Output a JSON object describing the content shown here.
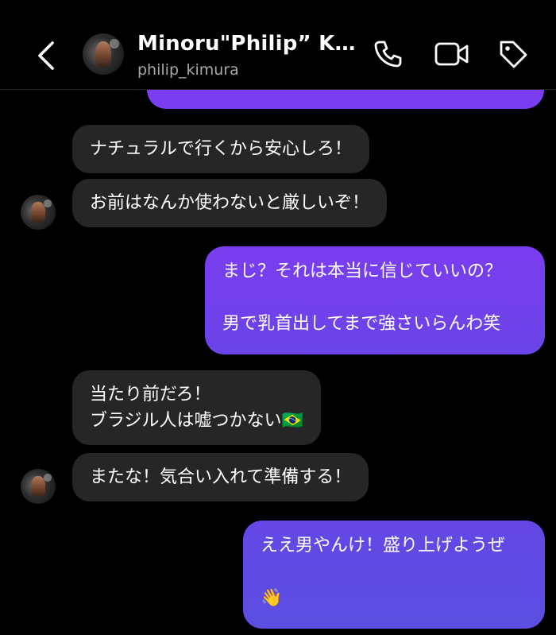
{
  "header": {
    "title": "Minoru\"Philip” Kim...",
    "username": "philip_kimura",
    "icons": [
      "chevron-left-icon",
      "phone-icon",
      "video-camera-icon",
      "tag-icon"
    ]
  },
  "colors": {
    "background": "#000000",
    "incoming_bubble": "#262626",
    "outgoing_gradient_top": "#7a3df0",
    "outgoing_gradient_bottom": "#5b4fe0",
    "subtext": "#a8a8a8"
  },
  "messages": [
    {
      "id": "m1",
      "from": "them",
      "text": "ナチュラルで行くから安心しろ！"
    },
    {
      "id": "m2",
      "from": "them",
      "text": "お前はなんか使わないと厳しいぞ！"
    },
    {
      "id": "m3",
      "from": "me",
      "text": "まじ？それは本当に信じていいの？\n\n男で乳首出してまで強さいらんわ笑"
    },
    {
      "id": "m4",
      "from": "them",
      "text": "当たり前だろ！\nブラジル人は嘘つかない🇧🇷"
    },
    {
      "id": "m5",
      "from": "them",
      "text": "またな！気合い入れて準備する！"
    },
    {
      "id": "m6",
      "from": "me",
      "text": "ええ男やんけ！盛り上げようぜ\n\n👋"
    }
  ]
}
